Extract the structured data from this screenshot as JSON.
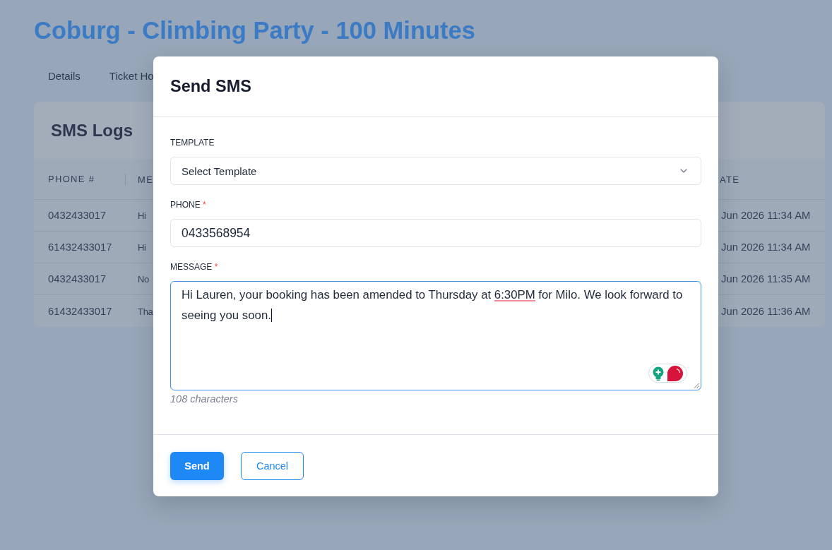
{
  "page": {
    "title": "Coburg - Climbing Party - 100 Minutes",
    "tabs": [
      "Details",
      "Ticket Ho"
    ]
  },
  "sms_logs": {
    "title": "SMS Logs",
    "columns": [
      "PHONE #",
      "ME",
      "ATE"
    ],
    "rows": [
      [
        "0432433017",
        "Hi",
        "Jun 2026 11:34 AM"
      ],
      [
        "61432433017",
        "Hi",
        "Jun 2026 11:34 AM"
      ],
      [
        "0432433017",
        "No",
        "Jun 2026 11:35 AM"
      ],
      [
        "61432433017",
        "Tha",
        "Jun 2026 11:36 AM"
      ]
    ]
  },
  "dialog": {
    "title": "Send SMS",
    "template": {
      "label": "TEMPLATE",
      "placeholder": "Select Template"
    },
    "phone": {
      "label": "PHONE",
      "required_mark": "*",
      "value": "0433568954"
    },
    "message": {
      "label": "MESSAGE",
      "required_mark": "*",
      "focused": true,
      "segments": [
        {
          "text": "Hi Lauren, your booking has been amended to Thursday at ",
          "flagged": false
        },
        {
          "text": "6:30PM",
          "flagged": true
        },
        {
          "text": " for Milo. We look forward to seeing you soon.",
          "flagged": false
        }
      ],
      "counter": "108 characters"
    },
    "buttons": [
      {
        "label": "Send",
        "kind": "primary"
      },
      {
        "label": "Cancel",
        "kind": "secondary"
      }
    ]
  }
}
